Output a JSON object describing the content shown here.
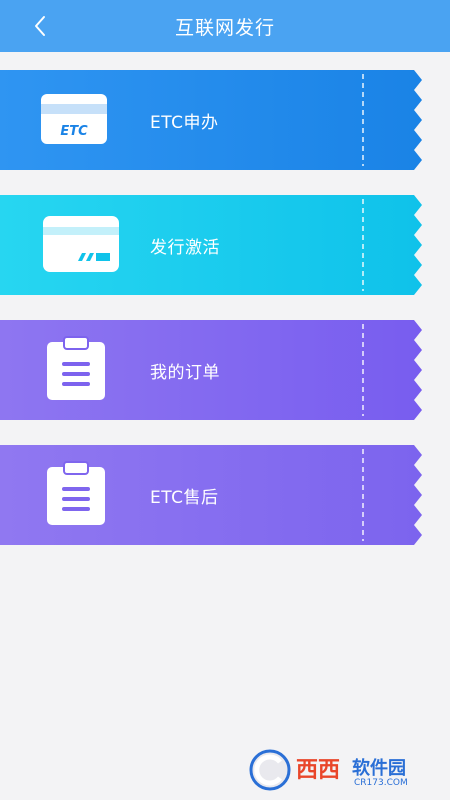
{
  "header": {
    "title": "互联网发行",
    "back_icon": "chevron-left-icon"
  },
  "menu": [
    {
      "label": "ETC申办",
      "icon": "etc-card-icon",
      "card_text": "ETC",
      "color_start": "#2f8ff0",
      "color_end": "#1b84e6"
    },
    {
      "label": "发行激活",
      "icon": "card-activate-icon",
      "color_start": "#21d1ef",
      "color_end": "#10c3ea"
    },
    {
      "label": "我的订单",
      "icon": "clipboard-icon",
      "color_start": "#8a6ff0",
      "color_end": "#7a60ef"
    },
    {
      "label": "ETC售后",
      "icon": "clipboard-icon",
      "color_start": "#8d74ef",
      "color_end": "#7f66ee"
    }
  ],
  "watermark": {
    "brand": "西西",
    "site": "软件园",
    "domain": "CR173.COM"
  }
}
